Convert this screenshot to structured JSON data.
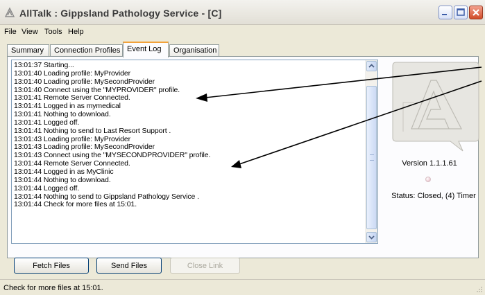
{
  "window": {
    "title": "AllTalk : Gippsland Pathology Service - [C]"
  },
  "menu": [
    "File",
    "View",
    "Tools",
    "Help"
  ],
  "tabs": [
    {
      "label": "Summary",
      "active": false
    },
    {
      "label": "Connection Profiles",
      "active": false
    },
    {
      "label": "Event Log",
      "active": true
    },
    {
      "label": "Organisation",
      "active": false
    }
  ],
  "event_log": [
    "13:01:37 Starting...",
    "13:01:40 Loading profile: MyProvider",
    "13:01:40 Loading profile: MySecondProvider",
    "13:01:40 Connect using the \"MYPROVIDER\" profile.",
    "13:01:41 Remote Server Connected.",
    "13:01:41 Logged in as mymedical",
    "13:01:41 Nothing to download.",
    "13:01:41 Logged off.",
    "13:01:41 Nothing to send to Last Resort Support .",
    "13:01:43 Loading profile: MyProvider",
    "13:01:43 Loading profile: MySecondProvider",
    "13:01:43 Connect using the \"MYSECONDPROVIDER\" profile.",
    "13:01:44 Remote Server Connected.",
    "13:01:44 Logged in as MyClinic",
    "13:01:44 Nothing to download.",
    "13:01:44 Logged off.",
    "13:01:44 Nothing to send to Gippsland Pathology Service .",
    "13:01:44 Check for more files at 15:01."
  ],
  "side_panel": {
    "version": "Version 1.1.1.61",
    "status": "Status: Closed, (4) Timer"
  },
  "buttons": {
    "fetch": "Fetch Files",
    "send": "Send Files",
    "close_link": "Close Link"
  },
  "status_bar": {
    "text": "Check for more files at 15:01."
  },
  "colors": {
    "annotation_arrow": "#000000",
    "active_tab_accent": "#F2A23A",
    "close_button": "#D14C28"
  }
}
